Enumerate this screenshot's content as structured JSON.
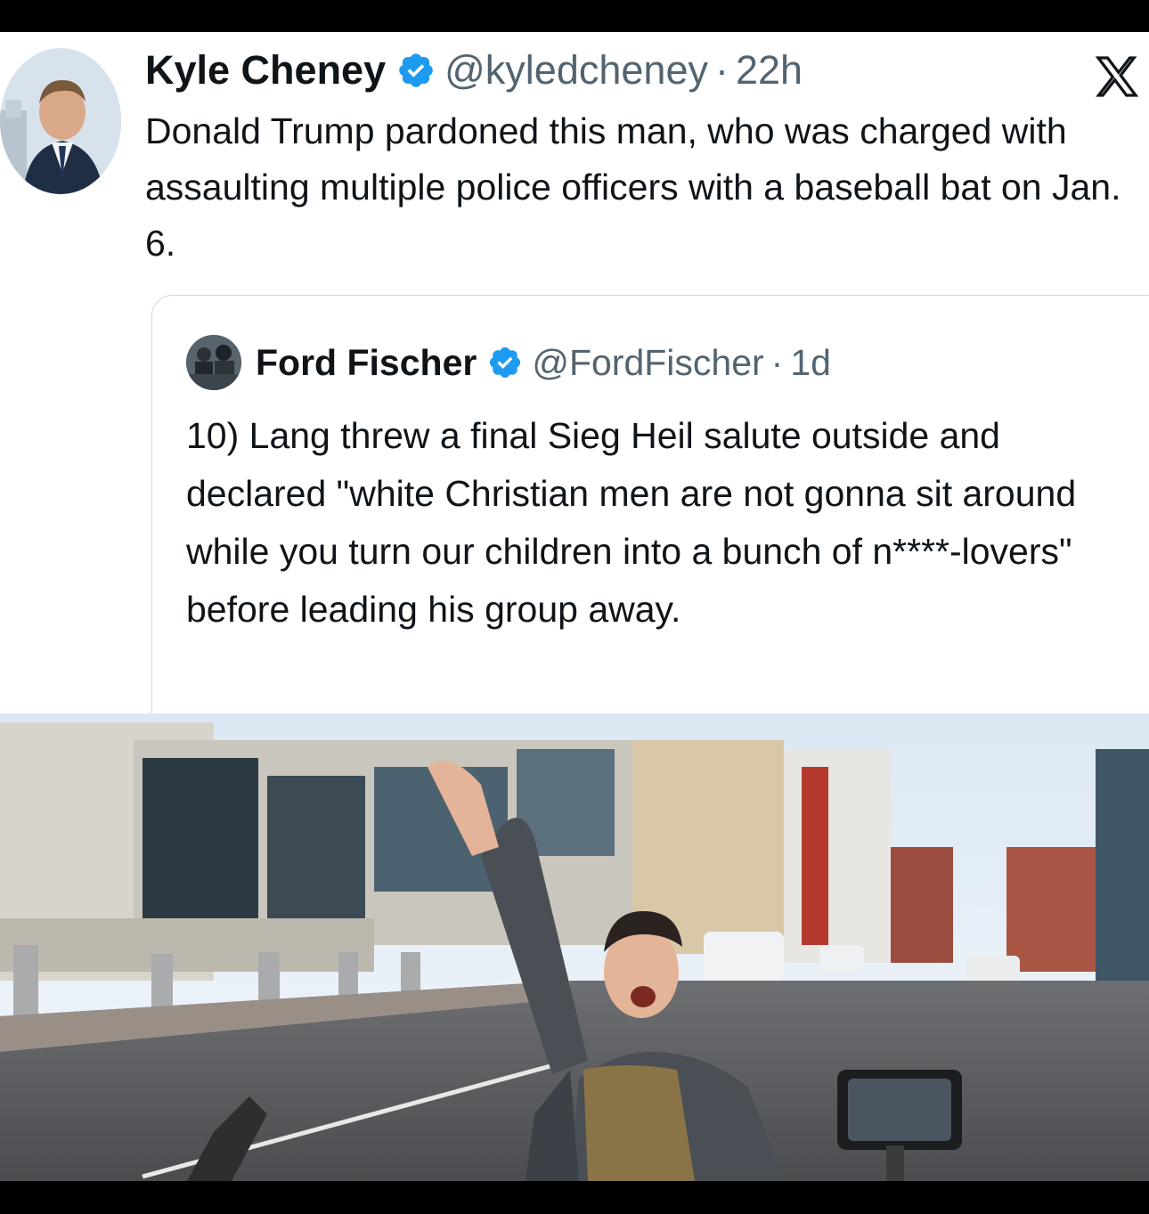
{
  "tweet": {
    "author_name": "Kyle Cheney",
    "handle": "@kyledcheney",
    "separator": "·",
    "time": "22h",
    "text": "Donald Trump pardoned this man, who was charged with assaulting multiple police officers with a baseball bat on Jan. 6."
  },
  "quoted_tweet": {
    "author_name": "Ford Fischer",
    "handle": "@FordFischer",
    "separator": "·",
    "time": "1d",
    "text": "10) Lang threw a final Sieg Heil salute outside and declared \"white Christian men are not gonna sit around while you turn our children into a bunch of n****-lovers\" before leading his group away."
  },
  "icons": {
    "verified": "verified-badge-icon",
    "platform": "x-logo-icon"
  },
  "colors": {
    "verified_blue": "#1d9bf0",
    "text_primary": "#0f1419",
    "text_secondary": "#536471",
    "border": "#cfd9de"
  }
}
